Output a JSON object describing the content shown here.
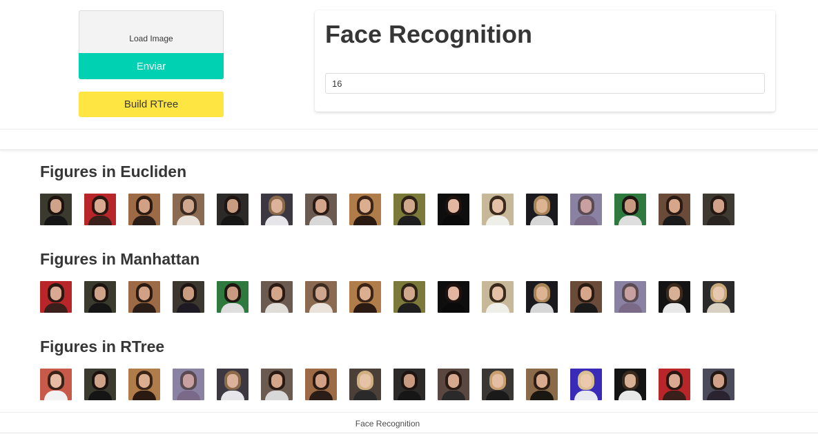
{
  "controls": {
    "load_image_label": "Load Image",
    "submit_label": "Enviar",
    "build_rtree_label": "Build RTree"
  },
  "card": {
    "title": "Face Recognition",
    "k_value": "16"
  },
  "sections": [
    {
      "title": "Figures in Eucliden",
      "images": [
        {
          "bg": "#3a3a2e",
          "hair": "#1c130f",
          "skin": "#cfa28a",
          "cloth": "#151515"
        },
        {
          "bg": "#b8262a",
          "hair": "#2a1712",
          "skin": "#d9a991",
          "cloth": "#3a1f1a"
        },
        {
          "bg": "#9c6a45",
          "hair": "#2b1a12",
          "skin": "#d2a085",
          "cloth": "#2a1c16"
        },
        {
          "bg": "#8a6a50",
          "hair": "#3a2a20",
          "skin": "#cfa78e",
          "cloth": "#e8e2da"
        },
        {
          "bg": "#2c2a28",
          "hair": "#1e1512",
          "skin": "#c99c82",
          "cloth": "#161616"
        },
        {
          "bg": "#3c3842",
          "hair": "#8a6a4a",
          "skin": "#dcb39a",
          "cloth": "#e6e6ea"
        },
        {
          "bg": "#6a5a50",
          "hair": "#2a1a14",
          "skin": "#d3a68c",
          "cloth": "#d8d8d8"
        },
        {
          "bg": "#b07d4a",
          "hair": "#3a2416",
          "skin": "#dcae90",
          "cloth": "#2a1a12"
        },
        {
          "bg": "#7c7a3a",
          "hair": "#2e2216",
          "skin": "#d0a98c",
          "cloth": "#1e1e1e"
        },
        {
          "bg": "#0e0e0e",
          "hair": "#1e120e",
          "skin": "#e2b6a0",
          "cloth": "#0a0a0a"
        },
        {
          "bg": "#c8b89a",
          "hair": "#3a2a1c",
          "skin": "#e4c0a6",
          "cloth": "#efefea"
        },
        {
          "bg": "#1a1a1e",
          "hair": "#a88458",
          "skin": "#dcb494",
          "cloth": "#d6d6d6"
        },
        {
          "bg": "#8a82a2",
          "hair": "#5a4a52",
          "skin": "#c8a0a0",
          "cloth": "#7a6a88"
        },
        {
          "bg": "#2e7a3e",
          "hair": "#1e1610",
          "skin": "#c89a80",
          "cloth": "#dedede"
        },
        {
          "bg": "#6a4a38",
          "hair": "#2a1a12",
          "skin": "#d6a68a",
          "cloth": "#1a1a1a"
        },
        {
          "bg": "#3e3a32",
          "hair": "#241812",
          "skin": "#d0a088",
          "cloth": "#2a2420"
        }
      ]
    },
    {
      "title": "Figures in Manhattan",
      "images": [
        {
          "bg": "#b8262a",
          "hair": "#2a1712",
          "skin": "#d9a991",
          "cloth": "#3a1f1a"
        },
        {
          "bg": "#3a3a2e",
          "hair": "#1c130f",
          "skin": "#cfa28a",
          "cloth": "#151515"
        },
        {
          "bg": "#9c6a45",
          "hair": "#2b1a12",
          "skin": "#d2a085",
          "cloth": "#2a1c16"
        },
        {
          "bg": "#3c3830",
          "hair": "#1e1512",
          "skin": "#c99c82",
          "cloth": "#1e1a24"
        },
        {
          "bg": "#2e7a3e",
          "hair": "#1e1610",
          "skin": "#c89a80",
          "cloth": "#dedede"
        },
        {
          "bg": "#6a5a50",
          "hair": "#2a1a14",
          "skin": "#d3a68c",
          "cloth": "#e0ddd8"
        },
        {
          "bg": "#8a6a50",
          "hair": "#3a2a20",
          "skin": "#cfa78e",
          "cloth": "#e8e2da"
        },
        {
          "bg": "#b07d4a",
          "hair": "#3a2416",
          "skin": "#dcae90",
          "cloth": "#2a1a12"
        },
        {
          "bg": "#7c7a3a",
          "hair": "#2e2216",
          "skin": "#d0a98c",
          "cloth": "#1e1e1e"
        },
        {
          "bg": "#0e0e0e",
          "hair": "#1e120e",
          "skin": "#e2b6a0",
          "cloth": "#0a0a0a"
        },
        {
          "bg": "#c8b89a",
          "hair": "#3a2a1c",
          "skin": "#e4c0a6",
          "cloth": "#efefea"
        },
        {
          "bg": "#1a1a1e",
          "hair": "#a88458",
          "skin": "#dcb494",
          "cloth": "#d6d6d6"
        },
        {
          "bg": "#6a4a38",
          "hair": "#2a1a12",
          "skin": "#d6a68a",
          "cloth": "#1a1a1a"
        },
        {
          "bg": "#8a82a2",
          "hair": "#5a4a52",
          "skin": "#c8a0a0",
          "cloth": "#7a6a88"
        },
        {
          "bg": "#141414",
          "hair": "#3a2a1e",
          "skin": "#d8b096",
          "cloth": "#e8e8e8"
        },
        {
          "bg": "#2a2a2a",
          "hair": "#c8a878",
          "skin": "#e6c8b0",
          "cloth": "#d8d0c0"
        }
      ]
    },
    {
      "title": "Figures in RTree",
      "images": [
        {
          "bg": "#c85a4a",
          "hair": "#3a2216",
          "skin": "#e8bca4",
          "cloth": "#f2f2f2"
        },
        {
          "bg": "#3a3a2e",
          "hair": "#1c130f",
          "skin": "#cfa28a",
          "cloth": "#151515"
        },
        {
          "bg": "#b07d4a",
          "hair": "#3a2416",
          "skin": "#dcae90",
          "cloth": "#2a1a12"
        },
        {
          "bg": "#8a82a2",
          "hair": "#5a4a52",
          "skin": "#c8a0a0",
          "cloth": "#7a6a88"
        },
        {
          "bg": "#3c3842",
          "hair": "#8a6a4a",
          "skin": "#dcb39a",
          "cloth": "#e6e6ea"
        },
        {
          "bg": "#6a5a50",
          "hair": "#2a1a14",
          "skin": "#d3a68c",
          "cloth": "#d8d8d8"
        },
        {
          "bg": "#9c6a45",
          "hair": "#2b1a12",
          "skin": "#d2a085",
          "cloth": "#2a1c16"
        },
        {
          "bg": "#4a4038",
          "hair": "#d0b080",
          "skin": "#e6c2a6",
          "cloth": "#2a2a2a"
        },
        {
          "bg": "#2c2a28",
          "hair": "#1e1512",
          "skin": "#c99c82",
          "cloth": "#161616"
        },
        {
          "bg": "#5a4840",
          "hair": "#2a1a14",
          "skin": "#d6a88e",
          "cloth": "#2a2a2a"
        },
        {
          "bg": "#3a3634",
          "hair": "#c8a070",
          "skin": "#e4bea2",
          "cloth": "#1a1a1a"
        },
        {
          "bg": "#8a6a48",
          "hair": "#2e1e14",
          "skin": "#d8aa8e",
          "cloth": "#1a1612"
        },
        {
          "bg": "#3a2ab8",
          "hair": "#d8c090",
          "skin": "#ecc8ae",
          "cloth": "#e8e8f0"
        },
        {
          "bg": "#141414",
          "hair": "#3a2a1e",
          "skin": "#d8b096",
          "cloth": "#e8e8e8"
        },
        {
          "bg": "#b8262a",
          "hair": "#2a1712",
          "skin": "#d9a991",
          "cloth": "#3a1f1a"
        },
        {
          "bg": "#4a4a5a",
          "hair": "#241812",
          "skin": "#d0a088",
          "cloth": "#2a2430"
        }
      ]
    }
  ],
  "footer": {
    "text": "Face Recognition"
  }
}
